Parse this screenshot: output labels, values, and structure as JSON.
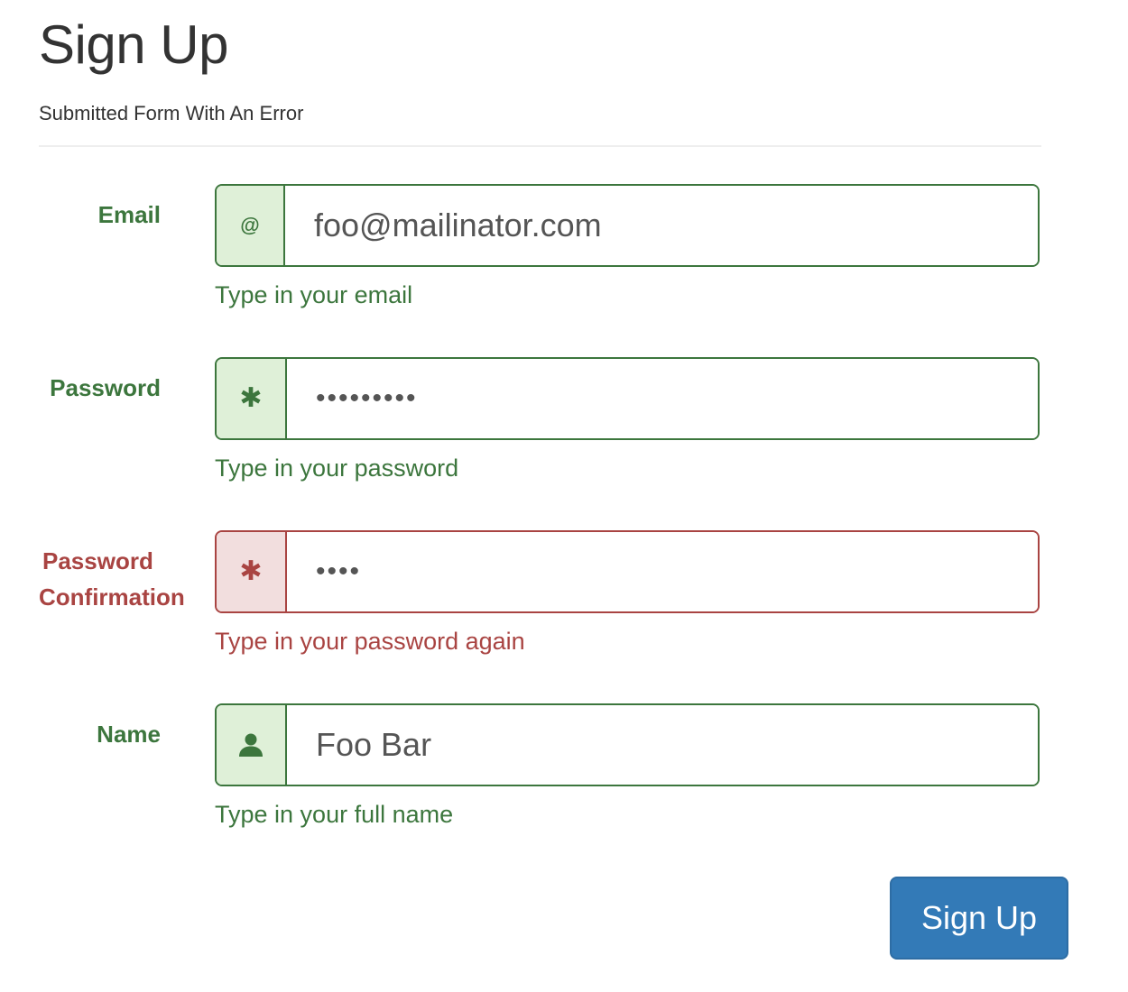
{
  "header": {
    "title": "Sign Up",
    "subtitle": "Submitted Form With An Error"
  },
  "form": {
    "email": {
      "label": "Email",
      "addon_icon": "@",
      "value": "foo@mailinator.com",
      "help": "Type in your email",
      "state": "success"
    },
    "password": {
      "label": "Password",
      "addon_icon": "✱",
      "value": "•••••••••",
      "help": "Type in your password",
      "state": "success"
    },
    "password_confirmation": {
      "label_line1": "Password",
      "label_line2": "Confirmation",
      "addon_icon": "✱",
      "value": "••••",
      "help": "Type in your password again",
      "state": "error"
    },
    "name": {
      "label": "Name",
      "value": "Foo Bar",
      "help": "Type in your full name",
      "state": "success"
    },
    "submit_label": "Sign Up"
  },
  "colors": {
    "success": "#3c763d",
    "success_bg": "#dff0d8",
    "error": "#a94442",
    "error_bg": "#f2dede",
    "primary": "#337ab7"
  },
  "icons": {
    "email": "at-icon",
    "password": "asterisk-icon",
    "password_confirmation": "asterisk-icon",
    "name": "user-icon"
  }
}
